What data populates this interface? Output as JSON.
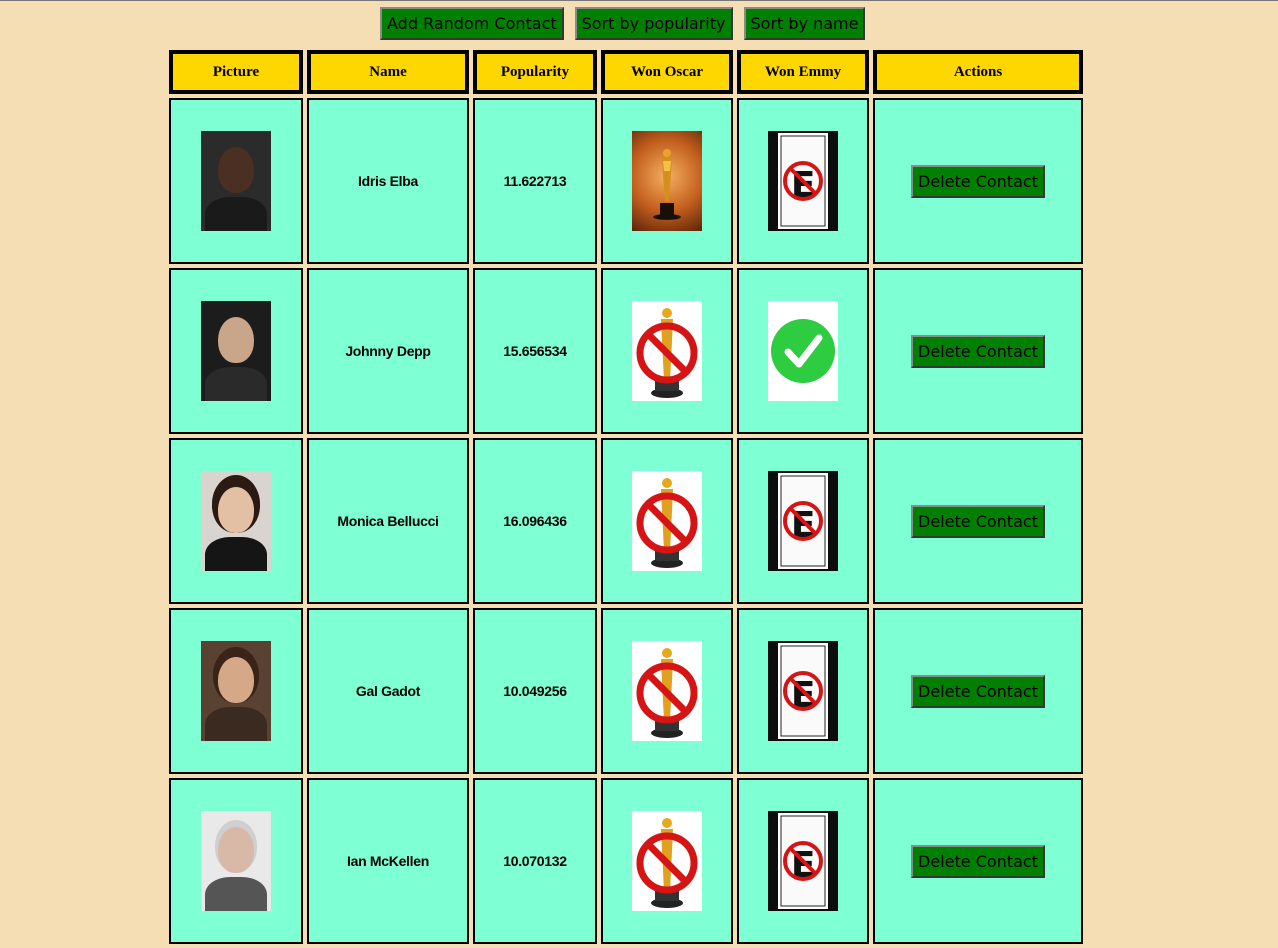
{
  "toolbar": {
    "add_label": "Add Random Contact",
    "sort_popularity_label": "Sort by popularity",
    "sort_name_label": "Sort by name"
  },
  "table": {
    "headers": [
      "Picture",
      "Name",
      "Popularity",
      "Won Oscar",
      "Won Emmy",
      "Actions"
    ],
    "rows": [
      {
        "name": "Idris Elba",
        "popularity": "11.622713",
        "won_oscar": true,
        "won_emmy": false,
        "action": "Delete Contact"
      },
      {
        "name": "Johnny Depp",
        "popularity": "15.656534",
        "won_oscar": false,
        "won_emmy": true,
        "action": "Delete Contact"
      },
      {
        "name": "Monica Bellucci",
        "popularity": "16.096436",
        "won_oscar": false,
        "won_emmy": false,
        "action": "Delete Contact"
      },
      {
        "name": "Gal Gadot",
        "popularity": "10.049256",
        "won_oscar": false,
        "won_emmy": false,
        "action": "Delete Contact"
      },
      {
        "name": "Ian McKellen",
        "popularity": "10.070132",
        "won_oscar": false,
        "won_emmy": false,
        "action": "Delete Contact"
      }
    ]
  },
  "icons": {
    "oscar_won": "oscar-statue-icon",
    "oscar_no": "no-oscar-icon",
    "emmy_won": "green-check-icon",
    "emmy_no": "no-emmy-sign-icon"
  },
  "colors": {
    "page_background": "#f5deb3",
    "header_background": "#ffd700",
    "cell_background": "#7fffd4",
    "button_background": "#008000"
  }
}
